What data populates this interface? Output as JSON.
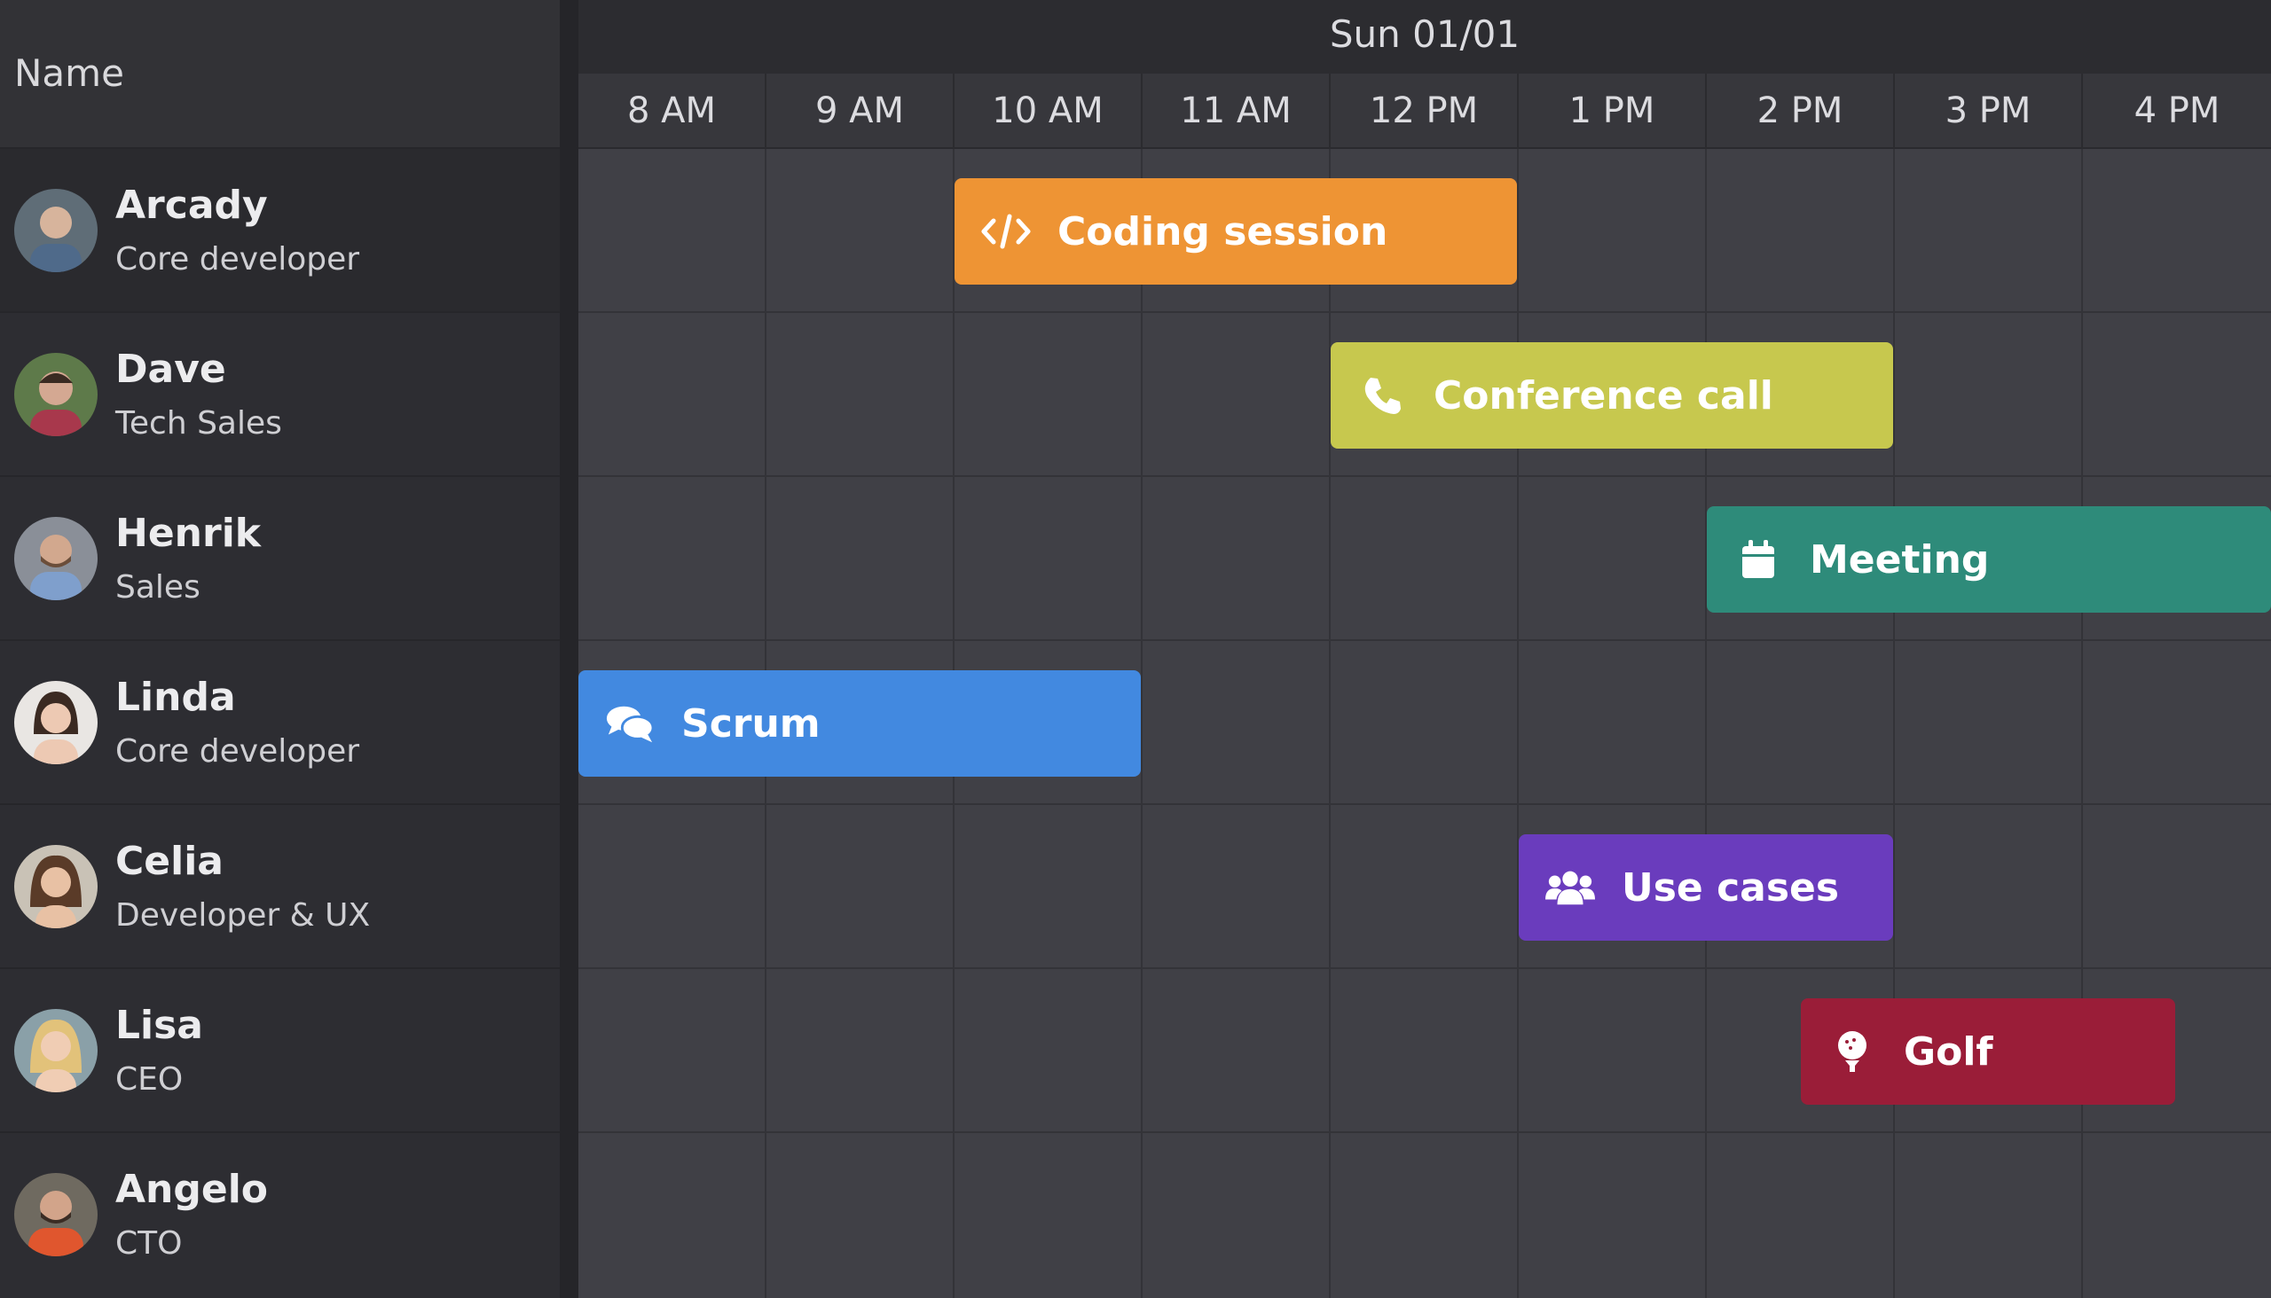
{
  "header": {
    "name_label": "Name",
    "date_label": "Sun 01/01",
    "hours": [
      "8 AM",
      "9 AM",
      "10 AM",
      "11 AM",
      "12 PM",
      "1 PM",
      "2 PM",
      "3 PM",
      "4 PM"
    ]
  },
  "resources": [
    {
      "name": "Arcady",
      "role": "Core developer"
    },
    {
      "name": "Dave",
      "role": "Tech Sales"
    },
    {
      "name": "Henrik",
      "role": "Sales"
    },
    {
      "name": "Linda",
      "role": "Core developer"
    },
    {
      "name": "Celia",
      "role": "Developer & UX"
    },
    {
      "name": "Lisa",
      "role": "CEO"
    },
    {
      "name": "Angelo",
      "role": "CTO"
    }
  ],
  "events": [
    {
      "name": "Coding session",
      "resource": "Arcady",
      "start": "10 AM",
      "end": "1 PM",
      "color": "#ee9434",
      "icon": "code-icon"
    },
    {
      "name": "Conference call",
      "resource": "Dave",
      "start": "12 PM",
      "end": "3 PM",
      "color": "#c7c84e",
      "icon": "phone-icon"
    },
    {
      "name": "Meeting",
      "resource": "Henrik",
      "start": "2 PM",
      "end": "5 PM",
      "color": "#2e8b7a",
      "icon": "calendar-icon"
    },
    {
      "name": "Scrum",
      "resource": "Linda",
      "start": "8 AM",
      "end": "11 AM",
      "color": "#4289e0",
      "icon": "comments-icon"
    },
    {
      "name": "Use cases",
      "resource": "Celia",
      "start": "1 PM",
      "end": "3 PM",
      "color": "#6a3cbd",
      "icon": "users-icon"
    },
    {
      "name": "Golf",
      "resource": "Lisa",
      "start": "2:30 PM",
      "end": "4:30 PM",
      "color": "#9a1d38",
      "icon": "golf-icon"
    }
  ]
}
